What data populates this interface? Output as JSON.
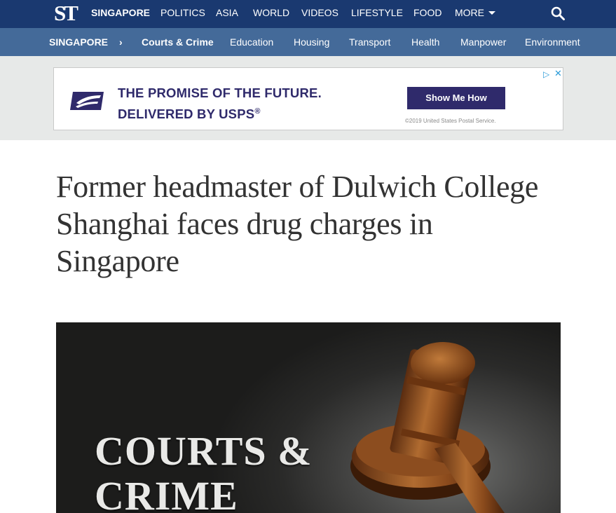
{
  "brand": {
    "logo_text": "ST"
  },
  "topnav": {
    "items": [
      {
        "label": "SINGAPORE",
        "active": true
      },
      {
        "label": "POLITICS"
      },
      {
        "label": "ASIA"
      },
      {
        "label": "WORLD"
      },
      {
        "label": "VIDEOS"
      },
      {
        "label": "LIFESTYLE"
      },
      {
        "label": "FOOD"
      },
      {
        "label": "MORE"
      }
    ]
  },
  "subnav": {
    "section": "SINGAPORE",
    "chevron": "›",
    "items": [
      {
        "label": "Courts & Crime",
        "active": true
      },
      {
        "label": "Education"
      },
      {
        "label": "Housing"
      },
      {
        "label": "Transport"
      },
      {
        "label": "Health"
      },
      {
        "label": "Manpower"
      },
      {
        "label": "Environment"
      }
    ]
  },
  "ad": {
    "headline_line1": "THE PROMISE OF THE FUTURE.",
    "headline_line2": "DELIVERED BY USPS",
    "registered_mark": "®",
    "button_label": "Show Me How",
    "legal": "©2019 United States Postal Service.",
    "adchoices_glyph": "▷",
    "close_glyph": "✕"
  },
  "article": {
    "headline": "Former headmaster of Dulwich College Shanghai faces drug charges in Singapore",
    "hero_text_line1": "COURTS &",
    "hero_text_line2": "CRIME"
  },
  "colors": {
    "topnav_bg": "#1a3970",
    "subnav_bg": "#446a99",
    "ad_band_bg": "#e7e9e8",
    "ad_brand": "#2f2a6b"
  }
}
